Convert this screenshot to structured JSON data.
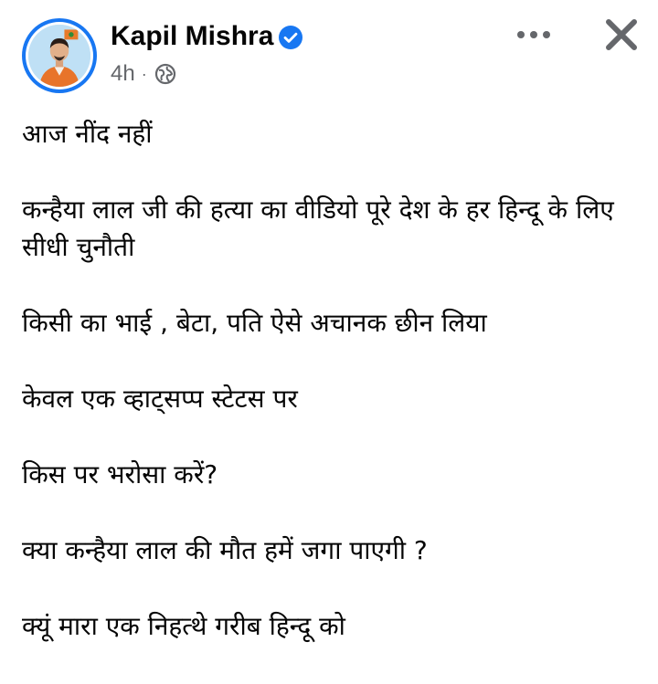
{
  "post": {
    "author": {
      "name": "Kapil Mishra",
      "verified": true,
      "avatar_icon": "profile-photo"
    },
    "timestamp": "4h",
    "separator": "·",
    "privacy_icon": "globe-icon",
    "more_icon": "more-options-icon",
    "close_icon": "close-icon",
    "paragraphs": [
      "आज नींद नहीं",
      "कन्हैया लाल जी की हत्या का वीडियो पूरे देश के हर हिन्दू के लिए सीधी चुनौती",
      "किसी का भाई , बेटा, पति ऐसे अचानक छीन लिया",
      "केवल एक व्हाट्सप्प स्टेटस पर",
      "किस पर भरोसा करें?",
      "क्या कन्हैया लाल की मौत हमें जगा पाएगी ?",
      "क्यूं मारा एक निहत्थे गरीब हिन्दू को"
    ]
  },
  "colors": {
    "accent": "#1877f2",
    "name": "#050505",
    "meta": "#65676b",
    "icon": "#65676b"
  }
}
